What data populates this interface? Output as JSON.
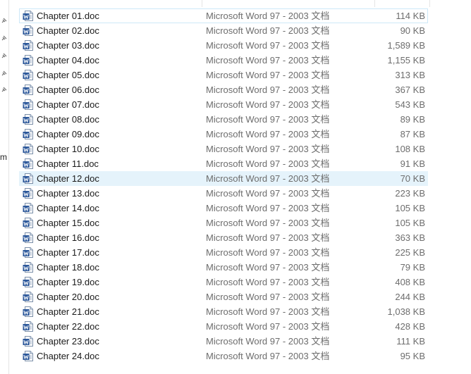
{
  "nav_pane": {
    "partial_text": "m"
  },
  "files": [
    {
      "name": "Chapter 01.doc",
      "type": "Microsoft Word 97 - 2003 文档",
      "size": "114 KB"
    },
    {
      "name": "Chapter 02.doc",
      "type": "Microsoft Word 97 - 2003 文档",
      "size": "90 KB"
    },
    {
      "name": "Chapter 03.doc",
      "type": "Microsoft Word 97 - 2003 文档",
      "size": "1,589 KB"
    },
    {
      "name": "Chapter 04.doc",
      "type": "Microsoft Word 97 - 2003 文档",
      "size": "1,155 KB"
    },
    {
      "name": "Chapter 05.doc",
      "type": "Microsoft Word 97 - 2003 文档",
      "size": "313 KB"
    },
    {
      "name": "Chapter 06.doc",
      "type": "Microsoft Word 97 - 2003 文档",
      "size": "367 KB"
    },
    {
      "name": "Chapter 07.doc",
      "type": "Microsoft Word 97 - 2003 文档",
      "size": "543 KB"
    },
    {
      "name": "Chapter 08.doc",
      "type": "Microsoft Word 97 - 2003 文档",
      "size": "89 KB"
    },
    {
      "name": "Chapter 09.doc",
      "type": "Microsoft Word 97 - 2003 文档",
      "size": "87 KB"
    },
    {
      "name": "Chapter 10.doc",
      "type": "Microsoft Word 97 - 2003 文档",
      "size": "108 KB"
    },
    {
      "name": "Chapter 11.doc",
      "type": "Microsoft Word 97 - 2003 文档",
      "size": "91 KB"
    },
    {
      "name": "Chapter 12.doc",
      "type": "Microsoft Word 97 - 2003 文档",
      "size": "70 KB"
    },
    {
      "name": "Chapter 13.doc",
      "type": "Microsoft Word 97 - 2003 文档",
      "size": "223 KB"
    },
    {
      "name": "Chapter 14.doc",
      "type": "Microsoft Word 97 - 2003 文档",
      "size": "105 KB"
    },
    {
      "name": "Chapter 15.doc",
      "type": "Microsoft Word 97 - 2003 文档",
      "size": "105 KB"
    },
    {
      "name": "Chapter 16.doc",
      "type": "Microsoft Word 97 - 2003 文档",
      "size": "363 KB"
    },
    {
      "name": "Chapter 17.doc",
      "type": "Microsoft Word 97 - 2003 文档",
      "size": "225 KB"
    },
    {
      "name": "Chapter 18.doc",
      "type": "Microsoft Word 97 - 2003 文档",
      "size": "79 KB"
    },
    {
      "name": "Chapter 19.doc",
      "type": "Microsoft Word 97 - 2003 文档",
      "size": "408 KB"
    },
    {
      "name": "Chapter 20.doc",
      "type": "Microsoft Word 97 - 2003 文档",
      "size": "244 KB"
    },
    {
      "name": "Chapter 21.doc",
      "type": "Microsoft Word 97 - 2003 文档",
      "size": "1,038 KB"
    },
    {
      "name": "Chapter 22.doc",
      "type": "Microsoft Word 97 - 2003 文档",
      "size": "428 KB"
    },
    {
      "name": "Chapter 23.doc",
      "type": "Microsoft Word 97 - 2003 文档",
      "size": "111 KB"
    },
    {
      "name": "Chapter 24.doc",
      "type": "Microsoft Word 97 - 2003 文档",
      "size": "95 KB"
    }
  ],
  "selected_file": "Chapter 12.doc",
  "focused_file": "Chapter 01.doc",
  "icon": "word-document-icon",
  "colors": {
    "selection": "#e5f3fb",
    "word_blue": "#2b579a",
    "secondary_text": "#6d6d6d"
  }
}
